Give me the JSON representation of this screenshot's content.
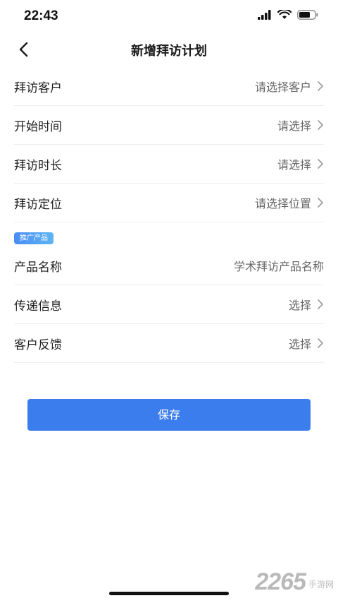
{
  "status_bar": {
    "time": "22:43"
  },
  "nav": {
    "title": "新增拜访计划",
    "back_icon": "chevron-left-icon"
  },
  "form": {
    "rows_top": [
      {
        "label": "拜访客户",
        "value": "请选择客户"
      },
      {
        "label": "开始时间",
        "value": "请选择"
      },
      {
        "label": "拜访时长",
        "value": "请选择"
      },
      {
        "label": "拜访定位",
        "value": "请选择位置"
      }
    ],
    "section_tag": "推广产品",
    "product": {
      "label": "产品名称",
      "value": "学术拜访产品名称"
    },
    "rows_bottom": [
      {
        "label": "传递信息",
        "value": "选择"
      },
      {
        "label": "客户反馈",
        "value": "选择"
      }
    ]
  },
  "save_label": "保存",
  "watermark": {
    "number": "2265",
    "text": "手游网"
  },
  "colors": {
    "primary": "#3b7ded",
    "tag_gradient_start": "#4a8df5",
    "tag_gradient_end": "#5fb4f2",
    "value_text": "#666666",
    "divider": "#eeeeee"
  }
}
